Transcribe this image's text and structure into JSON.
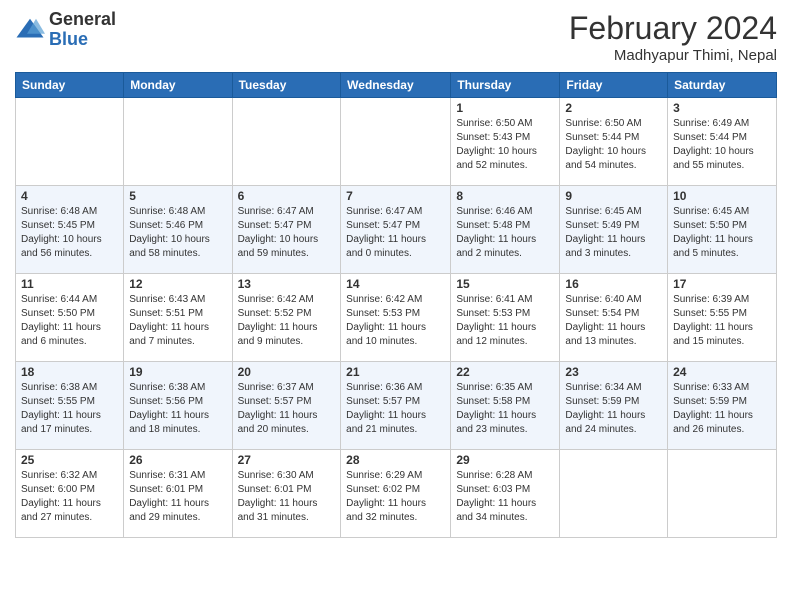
{
  "logo": {
    "general": "General",
    "blue": "Blue"
  },
  "title": "February 2024",
  "location": "Madhyapur Thimi, Nepal",
  "days_header": [
    "Sunday",
    "Monday",
    "Tuesday",
    "Wednesday",
    "Thursday",
    "Friday",
    "Saturday"
  ],
  "weeks": [
    [
      {
        "day": "",
        "content": ""
      },
      {
        "day": "",
        "content": ""
      },
      {
        "day": "",
        "content": ""
      },
      {
        "day": "",
        "content": ""
      },
      {
        "day": "1",
        "content": "Sunrise: 6:50 AM\nSunset: 5:43 PM\nDaylight: 10 hours and 52 minutes."
      },
      {
        "day": "2",
        "content": "Sunrise: 6:50 AM\nSunset: 5:44 PM\nDaylight: 10 hours and 54 minutes."
      },
      {
        "day": "3",
        "content": "Sunrise: 6:49 AM\nSunset: 5:44 PM\nDaylight: 10 hours and 55 minutes."
      }
    ],
    [
      {
        "day": "4",
        "content": "Sunrise: 6:48 AM\nSunset: 5:45 PM\nDaylight: 10 hours and 56 minutes."
      },
      {
        "day": "5",
        "content": "Sunrise: 6:48 AM\nSunset: 5:46 PM\nDaylight: 10 hours and 58 minutes."
      },
      {
        "day": "6",
        "content": "Sunrise: 6:47 AM\nSunset: 5:47 PM\nDaylight: 10 hours and 59 minutes."
      },
      {
        "day": "7",
        "content": "Sunrise: 6:47 AM\nSunset: 5:47 PM\nDaylight: 11 hours and 0 minutes."
      },
      {
        "day": "8",
        "content": "Sunrise: 6:46 AM\nSunset: 5:48 PM\nDaylight: 11 hours and 2 minutes."
      },
      {
        "day": "9",
        "content": "Sunrise: 6:45 AM\nSunset: 5:49 PM\nDaylight: 11 hours and 3 minutes."
      },
      {
        "day": "10",
        "content": "Sunrise: 6:45 AM\nSunset: 5:50 PM\nDaylight: 11 hours and 5 minutes."
      }
    ],
    [
      {
        "day": "11",
        "content": "Sunrise: 6:44 AM\nSunset: 5:50 PM\nDaylight: 11 hours and 6 minutes."
      },
      {
        "day": "12",
        "content": "Sunrise: 6:43 AM\nSunset: 5:51 PM\nDaylight: 11 hours and 7 minutes."
      },
      {
        "day": "13",
        "content": "Sunrise: 6:42 AM\nSunset: 5:52 PM\nDaylight: 11 hours and 9 minutes."
      },
      {
        "day": "14",
        "content": "Sunrise: 6:42 AM\nSunset: 5:53 PM\nDaylight: 11 hours and 10 minutes."
      },
      {
        "day": "15",
        "content": "Sunrise: 6:41 AM\nSunset: 5:53 PM\nDaylight: 11 hours and 12 minutes."
      },
      {
        "day": "16",
        "content": "Sunrise: 6:40 AM\nSunset: 5:54 PM\nDaylight: 11 hours and 13 minutes."
      },
      {
        "day": "17",
        "content": "Sunrise: 6:39 AM\nSunset: 5:55 PM\nDaylight: 11 hours and 15 minutes."
      }
    ],
    [
      {
        "day": "18",
        "content": "Sunrise: 6:38 AM\nSunset: 5:55 PM\nDaylight: 11 hours and 17 minutes."
      },
      {
        "day": "19",
        "content": "Sunrise: 6:38 AM\nSunset: 5:56 PM\nDaylight: 11 hours and 18 minutes."
      },
      {
        "day": "20",
        "content": "Sunrise: 6:37 AM\nSunset: 5:57 PM\nDaylight: 11 hours and 20 minutes."
      },
      {
        "day": "21",
        "content": "Sunrise: 6:36 AM\nSunset: 5:57 PM\nDaylight: 11 hours and 21 minutes."
      },
      {
        "day": "22",
        "content": "Sunrise: 6:35 AM\nSunset: 5:58 PM\nDaylight: 11 hours and 23 minutes."
      },
      {
        "day": "23",
        "content": "Sunrise: 6:34 AM\nSunset: 5:59 PM\nDaylight: 11 hours and 24 minutes."
      },
      {
        "day": "24",
        "content": "Sunrise: 6:33 AM\nSunset: 5:59 PM\nDaylight: 11 hours and 26 minutes."
      }
    ],
    [
      {
        "day": "25",
        "content": "Sunrise: 6:32 AM\nSunset: 6:00 PM\nDaylight: 11 hours and 27 minutes."
      },
      {
        "day": "26",
        "content": "Sunrise: 6:31 AM\nSunset: 6:01 PM\nDaylight: 11 hours and 29 minutes."
      },
      {
        "day": "27",
        "content": "Sunrise: 6:30 AM\nSunset: 6:01 PM\nDaylight: 11 hours and 31 minutes."
      },
      {
        "day": "28",
        "content": "Sunrise: 6:29 AM\nSunset: 6:02 PM\nDaylight: 11 hours and 32 minutes."
      },
      {
        "day": "29",
        "content": "Sunrise: 6:28 AM\nSunset: 6:03 PM\nDaylight: 11 hours and 34 minutes."
      },
      {
        "day": "",
        "content": ""
      },
      {
        "day": "",
        "content": ""
      }
    ]
  ]
}
